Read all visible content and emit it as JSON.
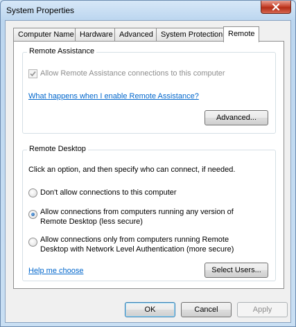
{
  "window": {
    "title": "System Properties",
    "close_icon": "close-icon"
  },
  "tabs": [
    {
      "label": "Computer Name"
    },
    {
      "label": "Hardware"
    },
    {
      "label": "Advanced"
    },
    {
      "label": "System Protection"
    },
    {
      "label": "Remote",
      "active": true
    }
  ],
  "remote_assistance": {
    "group_title": "Remote Assistance",
    "allow_label": "Allow Remote Assistance connections to this computer",
    "allow_checked": true,
    "allow_enabled": false,
    "help_link": "What happens when I enable Remote Assistance?",
    "advanced_button": "Advanced..."
  },
  "remote_desktop": {
    "group_title": "Remote Desktop",
    "instruction": "Click an option, and then specify who can connect, if needed.",
    "options": [
      {
        "label_line1": "Don't allow connections to this computer",
        "label_line2": "",
        "selected": false
      },
      {
        "label_line1": "Allow connections from computers running any version of",
        "label_line2": "Remote Desktop (less secure)",
        "selected": true
      },
      {
        "label_line1": "Allow connections only from computers running Remote",
        "label_line2": "Desktop with Network Level Authentication (more secure)",
        "selected": false
      }
    ],
    "help_link": "Help me choose",
    "select_users_button": "Select Users..."
  },
  "footer": {
    "ok": "OK",
    "cancel": "Cancel",
    "apply": "Apply"
  },
  "colors": {
    "link": "#0066cc",
    "close_button": "#c7452f"
  }
}
